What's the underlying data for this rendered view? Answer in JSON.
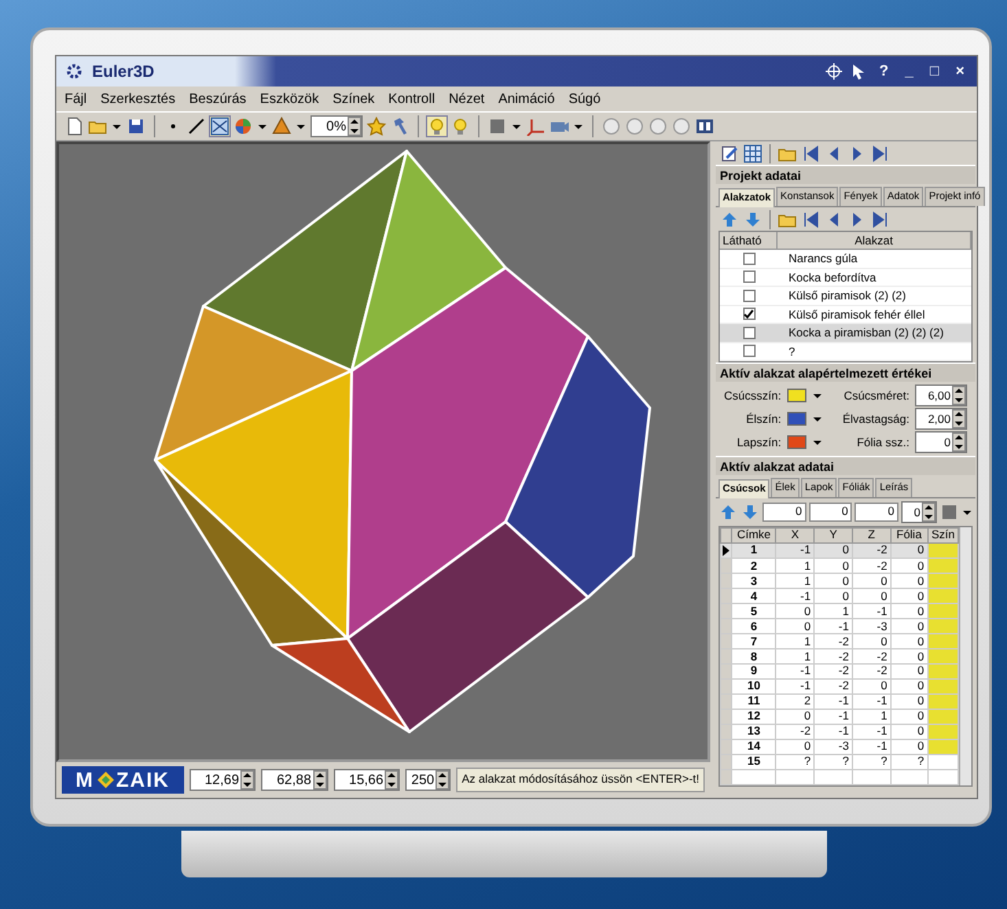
{
  "window": {
    "title": "Euler3D",
    "controls": [
      "?",
      "_",
      "□",
      "×"
    ]
  },
  "menu": [
    "Fájl",
    "Szerkesztés",
    "Beszúrás",
    "Eszközök",
    "Színek",
    "Kontroll",
    "Nézet",
    "Animáció",
    "Súgó"
  ],
  "toolbar": {
    "zoom": "0%"
  },
  "project": {
    "title": "Projekt adatai",
    "tabs": [
      {
        "label": "Alakzatok",
        "selected": true
      },
      {
        "label": "Konstansok",
        "selected": false
      },
      {
        "label": "Fények",
        "selected": false
      },
      {
        "label": "Adatok",
        "selected": false
      },
      {
        "label": "Projekt infó",
        "selected": false
      }
    ],
    "columns": [
      "Látható",
      "Alakzat"
    ],
    "shapes": [
      {
        "name": "Narancs gúla",
        "visible": false,
        "selected": false
      },
      {
        "name": "Kocka befordítva",
        "visible": false,
        "selected": false
      },
      {
        "name": "Külső piramisok (2) (2)",
        "visible": false,
        "selected": false
      },
      {
        "name": "Külső piramisok fehér éllel",
        "visible": true,
        "selected": false
      },
      {
        "name": "Kocka a piramisban (2) (2) (2)",
        "visible": false,
        "selected": true
      },
      {
        "name": "?",
        "visible": false,
        "selected": false
      }
    ]
  },
  "defaults": {
    "title": "Aktív alakzat alapértelmezett értékei",
    "colors": [
      {
        "label": "Csúcsszín:",
        "color": "#f0e020"
      },
      {
        "label": "Élszín:",
        "color": "#3050b8"
      },
      {
        "label": "Lapszín:",
        "color": "#e04818"
      }
    ],
    "values": [
      {
        "label": "Csúcsméret:",
        "value": "6,00"
      },
      {
        "label": "Élvastagság:",
        "value": "2,00"
      },
      {
        "label": "Fólia ssz.:",
        "value": "0"
      }
    ]
  },
  "shape_data": {
    "title": "Aktív alakzat adatai",
    "tabs": [
      {
        "label": "Csúcsok",
        "selected": true
      },
      {
        "label": "Élek",
        "selected": false
      },
      {
        "label": "Lapok",
        "selected": false
      },
      {
        "label": "Fóliák",
        "selected": false
      },
      {
        "label": "Leírás",
        "selected": false
      }
    ],
    "fields": [
      "0",
      "0",
      "0",
      "0"
    ],
    "columns": [
      "Címke",
      "X",
      "Y",
      "Z",
      "Fólia",
      "Szín"
    ],
    "rows": [
      {
        "cells": [
          "1",
          "-1",
          "0",
          "-2",
          "0"
        ],
        "color": "#e8e030",
        "selected": true
      },
      {
        "cells": [
          "2",
          "1",
          "0",
          "-2",
          "0"
        ],
        "color": "#e8e030",
        "selected": false
      },
      {
        "cells": [
          "3",
          "1",
          "0",
          "0",
          "0"
        ],
        "color": "#e8e030",
        "selected": false
      },
      {
        "cells": [
          "4",
          "-1",
          "0",
          "0",
          "0"
        ],
        "color": "#e8e030",
        "selected": false
      },
      {
        "cells": [
          "5",
          "0",
          "1",
          "-1",
          "0"
        ],
        "color": "#e8e030",
        "selected": false
      },
      {
        "cells": [
          "6",
          "0",
          "-1",
          "-3",
          "0"
        ],
        "color": "#e8e030",
        "selected": false
      },
      {
        "cells": [
          "7",
          "1",
          "-2",
          "0",
          "0"
        ],
        "color": "#e8e030",
        "selected": false
      },
      {
        "cells": [
          "8",
          "1",
          "-2",
          "-2",
          "0"
        ],
        "color": "#e8e030",
        "selected": false
      },
      {
        "cells": [
          "9",
          "-1",
          "-2",
          "-2",
          "0"
        ],
        "color": "#e8e030",
        "selected": false
      },
      {
        "cells": [
          "10",
          "-1",
          "-2",
          "0",
          "0"
        ],
        "color": "#e8e030",
        "selected": false
      },
      {
        "cells": [
          "11",
          "2",
          "-1",
          "-1",
          "0"
        ],
        "color": "#e8e030",
        "selected": false
      },
      {
        "cells": [
          "12",
          "0",
          "-1",
          "1",
          "0"
        ],
        "color": "#e8e030",
        "selected": false
      },
      {
        "cells": [
          "13",
          "-2",
          "-1",
          "-1",
          "0"
        ],
        "color": "#e8e030",
        "selected": false
      },
      {
        "cells": [
          "14",
          "0",
          "-3",
          "-1",
          "0"
        ],
        "color": "#e8e030",
        "selected": false
      },
      {
        "cells": [
          "15",
          "?",
          "?",
          "?",
          "?"
        ],
        "selected": false
      }
    ]
  },
  "status_bar": {
    "logo": {
      "before": "M",
      "after": "ZAIK"
    },
    "spinners": [
      "12,69",
      "62,88",
      "15,66",
      "250"
    ],
    "message": "Az alakzat módosításához üssön <ENTER>-t!"
  }
}
